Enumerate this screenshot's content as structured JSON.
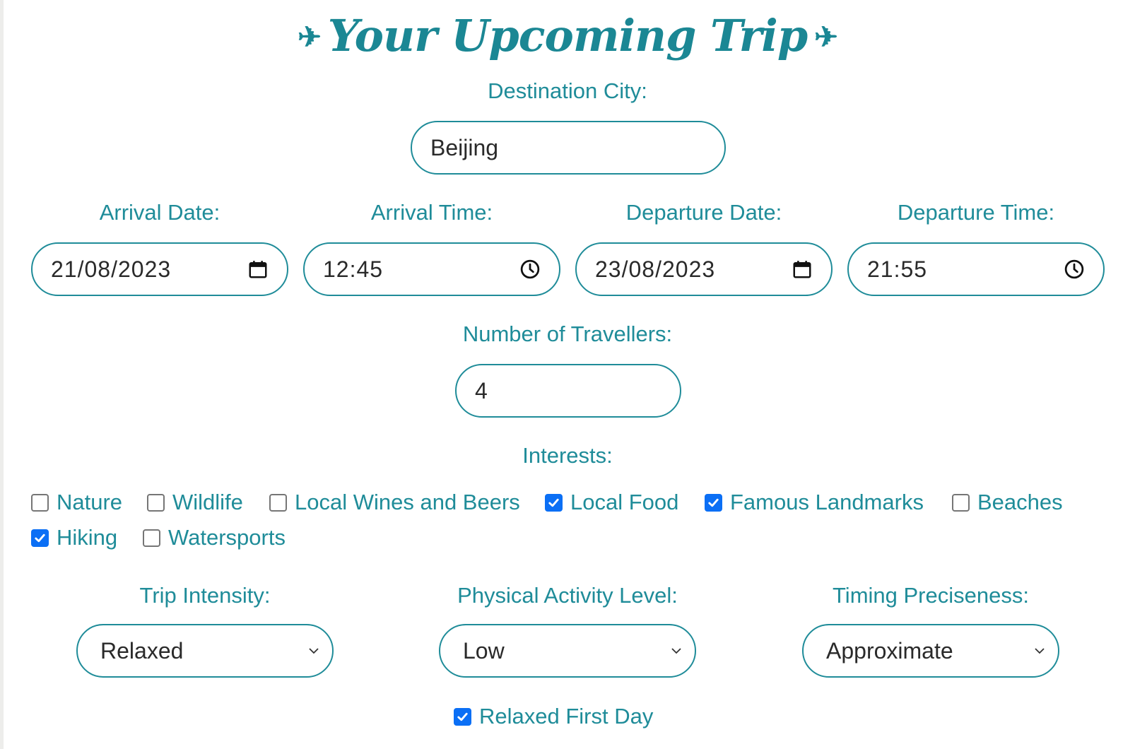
{
  "page": {
    "title": "Your Upcoming Trip",
    "title_icon": "airplane-icon",
    "title_glyph": "✈"
  },
  "destination": {
    "label": "Destination City:",
    "value": "Beijing"
  },
  "arrival_date": {
    "label": "Arrival Date:",
    "value": "21/08/2023",
    "icon": "calendar-icon"
  },
  "arrival_time": {
    "label": "Arrival Time:",
    "value": "12:45",
    "icon": "clock-icon"
  },
  "departure_date": {
    "label": "Departure Date:",
    "value": "23/08/2023",
    "icon": "calendar-icon"
  },
  "departure_time": {
    "label": "Departure Time:",
    "value": "21:55",
    "icon": "clock-icon"
  },
  "travellers": {
    "label": "Number of Travellers:",
    "value": "4"
  },
  "interests": {
    "label": "Interests:",
    "items": [
      {
        "label": "Nature",
        "checked": false
      },
      {
        "label": "Wildlife",
        "checked": false
      },
      {
        "label": "Local Wines and Beers",
        "checked": false
      },
      {
        "label": "Local Food",
        "checked": true
      },
      {
        "label": "Famous Landmarks",
        "checked": true
      },
      {
        "label": "Beaches",
        "checked": false
      },
      {
        "label": "Hiking",
        "checked": true
      },
      {
        "label": "Watersports",
        "checked": false
      }
    ]
  },
  "trip_intensity": {
    "label": "Trip Intensity:",
    "value": "Relaxed"
  },
  "activity_level": {
    "label": "Physical Activity Level:",
    "value": "Low"
  },
  "timing": {
    "label": "Timing Preciseness:",
    "value": "Approximate"
  },
  "relaxed_first_day": {
    "label": "Relaxed First Day",
    "checked": true
  },
  "colors": {
    "accent": "#1f8c99",
    "title": "#1b8794",
    "checkbox_checked": "#0b6ff5",
    "text": "#2a2a2a"
  }
}
